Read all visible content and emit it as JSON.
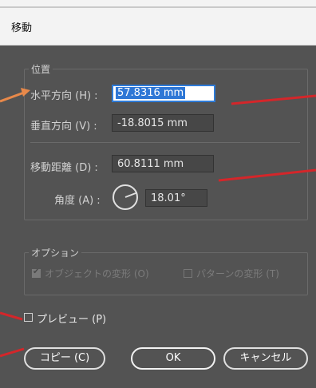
{
  "window": {
    "title": "移動"
  },
  "position_group": {
    "legend": "位置",
    "horizontal_label": "水平方向 (H) :",
    "horizontal_value": "57.8316 mm",
    "vertical_label": "垂直方向 (V) :",
    "vertical_value": "-18.8015 mm",
    "distance_label": "移動距離 (D) :",
    "distance_value": "60.8111 mm",
    "angle_label": "角度 (A) :",
    "angle_value": "18.01°"
  },
  "options_group": {
    "legend": "オプション",
    "transform_objects_label": "オブジェクトの変形 (O)",
    "transform_objects_checked": true,
    "transform_patterns_label": "パターンの変形 (T)",
    "transform_patterns_checked": false
  },
  "preview": {
    "label": "プレビュー (P)",
    "checked": false
  },
  "buttons": {
    "copy": "コピー (C)",
    "ok": "OK",
    "cancel": "キャンセル"
  },
  "annotation_colors": {
    "arrow_orange": "#e8894a",
    "marker_red": "#d4262a"
  }
}
